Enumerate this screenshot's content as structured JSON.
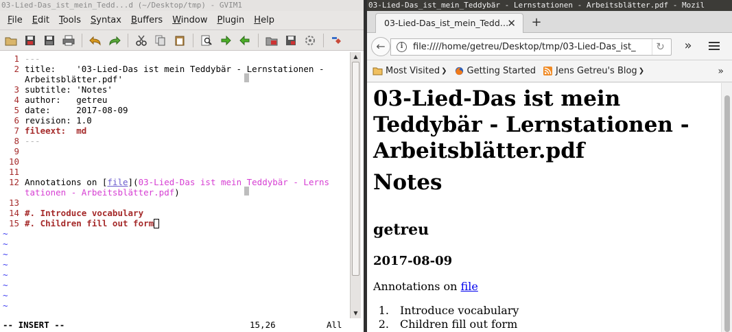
{
  "gvim": {
    "title": "03-Lied-Das_ist_mein_Tedd...d (~/Desktop/tmp) - GVIM1",
    "menu": [
      {
        "pre": "",
        "u": "F",
        "post": "ile"
      },
      {
        "pre": "",
        "u": "E",
        "post": "dit"
      },
      {
        "pre": "",
        "u": "T",
        "post": "ools"
      },
      {
        "pre": "",
        "u": "S",
        "post": "yntax"
      },
      {
        "pre": "",
        "u": "B",
        "post": "uffers"
      },
      {
        "pre": "",
        "u": "W",
        "post": "indow"
      },
      {
        "pre": "",
        "u": "P",
        "post": "lugin"
      },
      {
        "pre": "",
        "u": "H",
        "post": "elp"
      }
    ],
    "toolbar_icons": [
      "open-icon",
      "save-icon",
      "save-all-icon",
      "print-icon",
      "undo-icon",
      "redo-icon",
      "cut-icon",
      "copy-icon",
      "paste-icon",
      "find-replace-icon",
      "find-next-icon",
      "find-prev-icon",
      "load-session-icon",
      "save-session-icon",
      "run-script-icon",
      "tag-jump-icon"
    ],
    "lines": {
      "l1": "---",
      "l2a_key": "title:    ",
      "l2a_val": "'03-Lied-Das ist mein Teddybär - Lernstationen -",
      "l2b": "Arbeitsblätter.pdf'",
      "l3": "subtitle: 'Notes'",
      "l4": "author:   getreu",
      "l5": "date:     2017-08-09",
      "l6": "revision: 1.0",
      "l7_key": "fileext:  ",
      "l7_val": "md",
      "l8": "---",
      "l12_pre": "Annotations on [",
      "l12_link": "file",
      "l12_mid": "](",
      "l12_target": "03-Lied-Das ist mein Teddybär - Lerns",
      "l12b_target": "tationen - Arbeitsblätter.pdf",
      "l12b_close": ")",
      "l14": "#. Introduce vocabulary",
      "l15": "#. Children fill out form"
    },
    "line_numbers": [
      "1",
      "2",
      "3",
      "4",
      "5",
      "6",
      "7",
      "8",
      "9",
      "10",
      "11",
      "12",
      "13",
      "14",
      "15"
    ],
    "tilde": "~",
    "status": {
      "mode": "-- INSERT --",
      "position": "15,26",
      "percent": "All"
    }
  },
  "firefox": {
    "title": "03-Lied-Das_ist_mein_Teddybär - Lernstationen - Arbeitsblätter.pdf - Mozil",
    "tab_title": "03-Lied-Das_ist_mein_Tedd…",
    "url": "file:////home/getreu/Desktop/tmp/03-Lied-Das_ist_",
    "bookmarks": [
      "Most Visited",
      "Getting Started",
      "Jens Getreu's Blog"
    ],
    "page": {
      "title_line1": "03-Lied-Das ist mein",
      "title_line2": "Teddybär - Lernstationen -",
      "title_line3": "Arbeitsblätter.pdf",
      "subtitle": "Notes",
      "author": "getreu",
      "date": "2017-08-09",
      "annotations_prefix": "Annotations on ",
      "annotations_link": "file",
      "list": [
        {
          "num": "1.",
          "text": "Introduce vocabulary"
        },
        {
          "num": "2.",
          "text": "Children fill out form"
        }
      ]
    }
  },
  "colors": {
    "vim_linenr": "#a52a2a",
    "vim_string": "#d63ed3",
    "vim_keyword": "#a52a2a",
    "vim_tilde": "#3a3af0",
    "link_blue": "#0000ee"
  }
}
